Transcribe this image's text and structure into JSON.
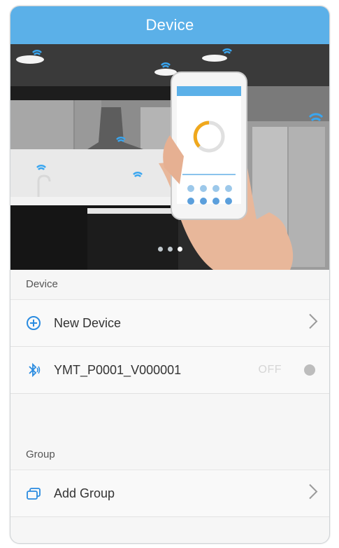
{
  "header": {
    "title": "Device"
  },
  "device_section": {
    "label": "Device"
  },
  "new_device": {
    "label": "New Device"
  },
  "device_item": {
    "name": "YMT_P0001_V000001",
    "status": "OFF"
  },
  "group_section": {
    "label": "Group"
  },
  "add_group": {
    "label": "Add Group"
  },
  "carousel": {
    "pages": 3,
    "active_page": 3
  },
  "colors": {
    "header_bg": "#5bb0e8",
    "accent": "#2a8be0"
  },
  "icons": [
    "plus-circle-icon",
    "bluetooth-icon",
    "chevron-right-icon",
    "cards-icon",
    "wifi-icon"
  ]
}
